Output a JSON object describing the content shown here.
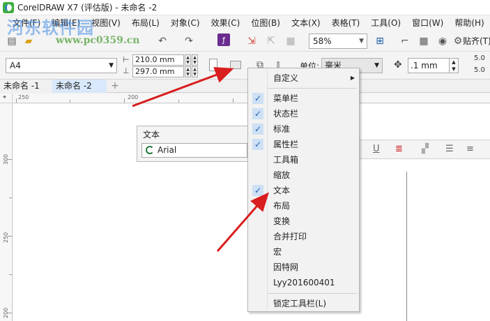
{
  "window": {
    "title": "CorelDRAW X7 (评估版) - 未命名 -2"
  },
  "menubar": {
    "items": [
      "文件(F)",
      "编辑(E)",
      "视图(V)",
      "布局(L)",
      "对象(C)",
      "效果(C)",
      "位图(B)",
      "文本(X)",
      "表格(T)",
      "工具(O)",
      "窗口(W)",
      "帮助(H)"
    ]
  },
  "watermark": {
    "text": "河东软件园",
    "url": "www.pc0359.cn"
  },
  "standard_toolbar": {
    "zoom": "58%",
    "snap_label": "贴齐(T)"
  },
  "property_bar": {
    "page_size": "A4",
    "width": "210.0 mm",
    "height": "297.0 mm",
    "unit_label": "单位:",
    "unit_value": "毫米",
    "nudge": ".1 mm",
    "dup_x": "5.0",
    "dup_y": "5.0"
  },
  "document_tabs": [
    {
      "label": "未命名 -1",
      "active": false
    },
    {
      "label": "未命名 -2",
      "active": true
    }
  ],
  "rulers": {
    "h_labels": [
      "250",
      "200"
    ],
    "v_labels": [
      "300",
      "250",
      "200"
    ]
  },
  "text_toolbar": {
    "title": "文本",
    "font": "Arial"
  },
  "context_menu": {
    "items": [
      {
        "label": "自定义",
        "checked": false,
        "submenu": true
      },
      {
        "label": "菜单栏",
        "checked": true
      },
      {
        "label": "状态栏",
        "checked": true
      },
      {
        "label": "标准",
        "checked": true
      },
      {
        "label": "属性栏",
        "checked": true
      },
      {
        "label": "工具箱",
        "checked": false
      },
      {
        "label": "缩放",
        "checked": false
      },
      {
        "label": "文本",
        "checked": true
      },
      {
        "label": "布局",
        "checked": false
      },
      {
        "label": "变换",
        "checked": false
      },
      {
        "label": "合并打印",
        "checked": false
      },
      {
        "label": "宏",
        "checked": false
      },
      {
        "label": "因特网",
        "checked": false
      },
      {
        "label": "Lyy201600401",
        "checked": false
      },
      {
        "label": "锁定工具栏(L)",
        "checked": false
      }
    ],
    "check_mark": "✓",
    "submenu_arrow": "▶"
  },
  "colors": {
    "arrow": "#d81e1e",
    "check_bg": "#cde0f5",
    "active_tab": "#d9e8fb"
  }
}
